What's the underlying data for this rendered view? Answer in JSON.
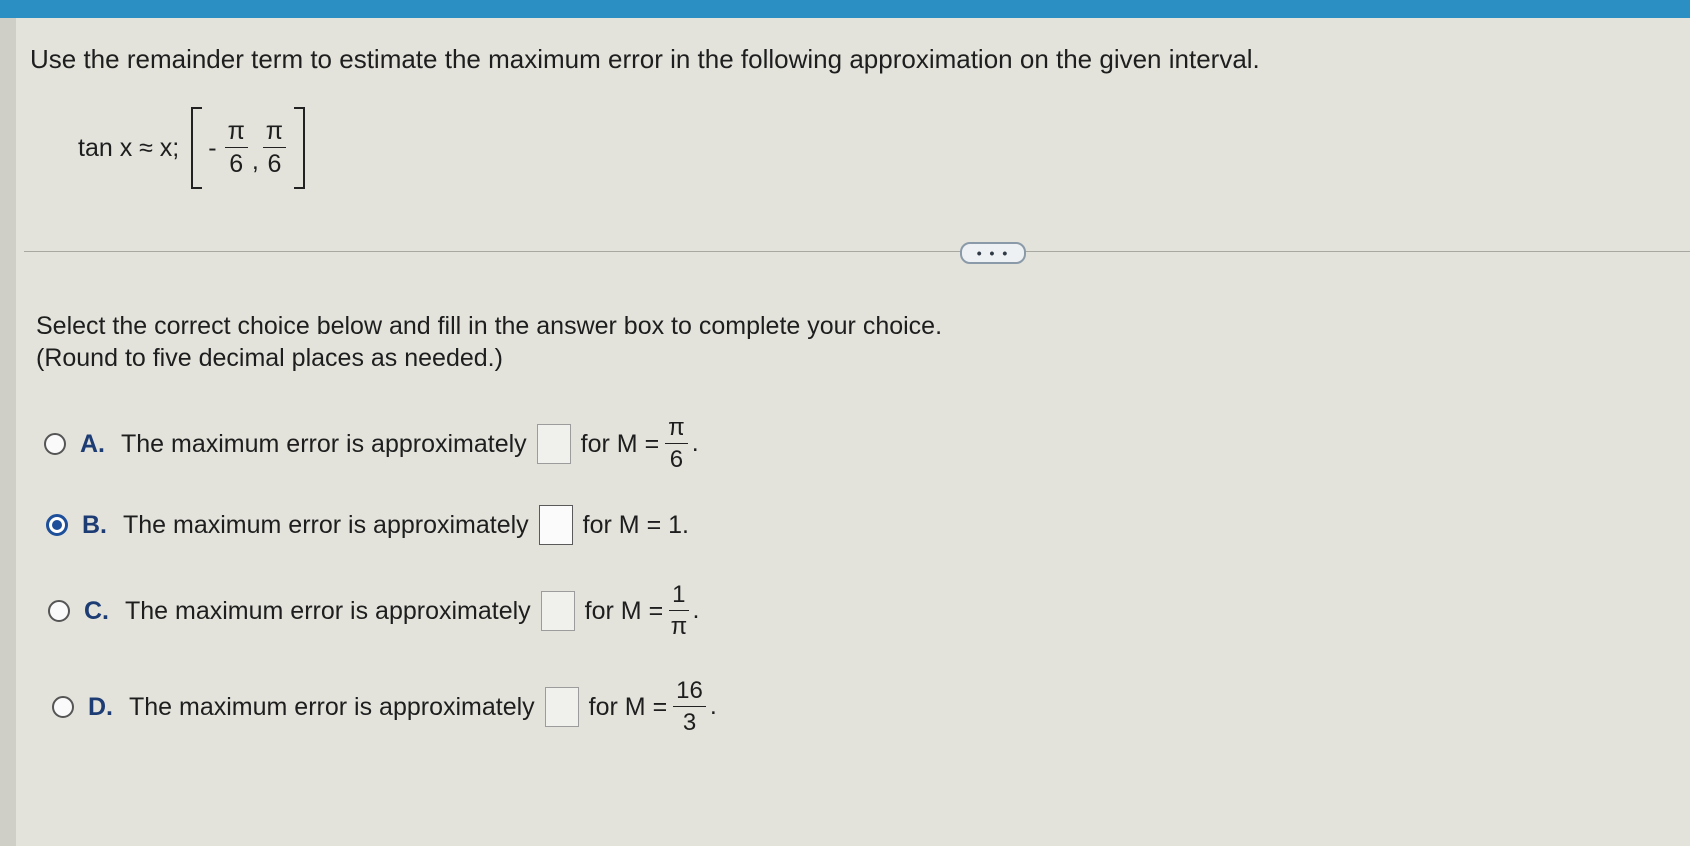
{
  "question": {
    "text": "Use the remainder term to estimate the maximum error in the following approximation on the given interval.",
    "formula_lhs": "tan x ≈ x;",
    "interval": {
      "low_sign": "-",
      "low_num": "π",
      "low_den": "6",
      "separator": ",",
      "high_num": "π",
      "high_den": "6"
    }
  },
  "more_button": "• • •",
  "instructions": {
    "line1": "Select the correct choice below and fill in the answer box to complete your choice.",
    "line2": "(Round to five decimal places as needed.)"
  },
  "choices": [
    {
      "letter": "A.",
      "text": "The maximum error is approximately",
      "answer": "",
      "suffix": "for M =",
      "m_num": "π",
      "m_den": "6",
      "end": ".",
      "selected": false
    },
    {
      "letter": "B.",
      "text": "The maximum error is approximately",
      "answer": "",
      "suffix": "for M = 1.",
      "selected": true
    },
    {
      "letter": "C.",
      "text": "The maximum error is approximately",
      "answer": "",
      "suffix": "for M =",
      "m_num": "1",
      "m_den": "π",
      "end": ".",
      "selected": false
    },
    {
      "letter": "D.",
      "text": "The maximum error is approximately",
      "answer": "",
      "suffix": "for M =",
      "m_num": "16",
      "m_den": "3",
      "end": ".",
      "selected": false
    }
  ]
}
